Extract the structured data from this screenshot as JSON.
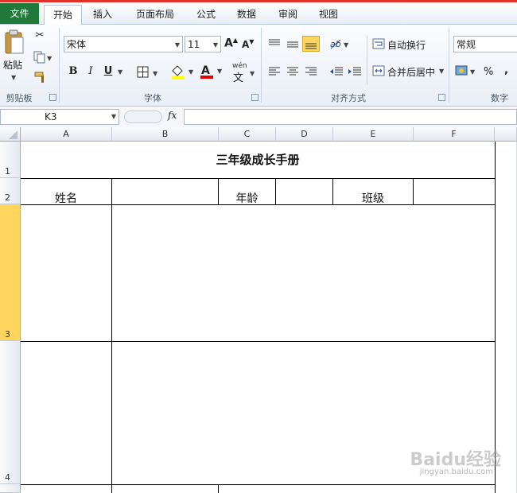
{
  "ribbon_tabs": [
    "文件",
    "开始",
    "插入",
    "页面布局",
    "公式",
    "数据",
    "审阅",
    "视图"
  ],
  "active_tab": "开始",
  "clipboard": {
    "paste_label": "粘贴",
    "group_label": "剪贴板"
  },
  "font": {
    "name": "宋体",
    "size": "11",
    "bold_label": "B",
    "italic_label": "I",
    "underline_label": "U",
    "phonetic_label": "wén",
    "group_label": "字体"
  },
  "alignment": {
    "wrap_text_label": "自动换行",
    "merge_center_label": "合并后居中",
    "group_label": "对齐方式"
  },
  "number": {
    "format": "常规",
    "percent_label": "%",
    "comma_label": ",",
    "group_label": "数字"
  },
  "colors": {
    "file_tab": "#1f7a3a",
    "selected_row_header": "#ffd55e",
    "font_color_bar": "#e00000",
    "fill_color_bar": "#ffff00"
  },
  "formula_bar": {
    "name_box": "K3",
    "fx_label": "fx",
    "formula": ""
  },
  "sheet": {
    "columns": [
      "A",
      "B",
      "C",
      "D",
      "E",
      "F"
    ],
    "rows": [
      "1",
      "2",
      "3",
      "4"
    ],
    "title": "三年级成长手册",
    "labels": {
      "name": "姓名",
      "age": "年龄",
      "class": "班级"
    }
  },
  "watermark": {
    "brand": "Baidu经验",
    "url": "jingyan.baidu.com"
  }
}
